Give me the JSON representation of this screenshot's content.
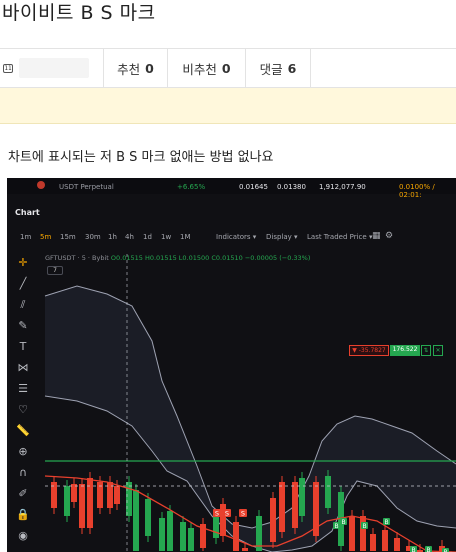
{
  "post": {
    "title": "바이비트 B S 마크",
    "avatar_glyph": "11",
    "stats": {
      "recommend_label": "추천",
      "recommend_count": "0",
      "not_recommend_label": "비추천",
      "not_recommend_count": "0",
      "comment_label": "댓글",
      "comment_count": "6"
    },
    "body": "차트에 표시되는 저 B S 마크 없애는 방법 없나요"
  },
  "screenshot": {
    "ticker": {
      "pair": "USDT Perpetual",
      "change": "+6.65%",
      "v1": "0.01645",
      "v2": "0.01380",
      "volume": "1,912,077.90",
      "funding": "0.0100% / 02:01:"
    },
    "panel_title": "Chart",
    "timeframes": [
      "1m",
      "5m",
      "15m",
      "30m",
      "1h",
      "4h",
      "1d",
      "1w",
      "1M"
    ],
    "active_timeframe": "5m",
    "menus": [
      "Indicators",
      "Display",
      "Last Traded Price"
    ],
    "symbol_info": "GFTUSDT · 5 · Bybit",
    "ohlc": "O0.01515  H0.01515  L0.01500  C0.01510  −0.00005 (−0.33%)",
    "collapse_label": "7",
    "price_tag_sell": "▼ -35.7827",
    "price_tag_buy": "176.522",
    "marker_buy": "B",
    "marker_sell": "S",
    "colors": {
      "up": "#25a750",
      "down": "#e8402d",
      "accent": "#f7a600",
      "bg": "#101014"
    },
    "tools": [
      "crosshair-icon",
      "trend-line-icon",
      "parallel-channel-icon",
      "brush-icon",
      "text-icon",
      "pattern-icon",
      "fib-icon",
      "heart-icon",
      "ruler-icon",
      "zoom-in-icon",
      "magnet-icon",
      "lock-draw-icon",
      "lock-icon",
      "eye-icon"
    ]
  }
}
